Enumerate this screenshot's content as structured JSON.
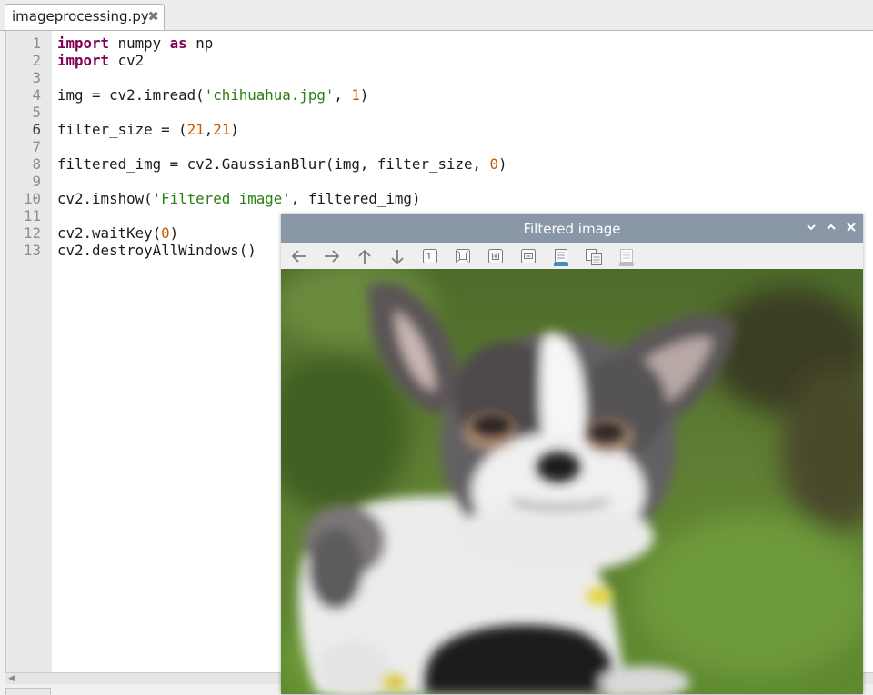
{
  "editor": {
    "tab": {
      "filename": "imageprocessing.py",
      "close_glyph": "✖"
    },
    "lines": [
      {
        "num": "1",
        "tokens": [
          {
            "t": "import",
            "c": "kw"
          },
          {
            "t": " numpy ",
            "c": ""
          },
          {
            "t": "as",
            "c": "kw"
          },
          {
            "t": " np",
            "c": ""
          }
        ]
      },
      {
        "num": "2",
        "tokens": [
          {
            "t": "import",
            "c": "kw"
          },
          {
            "t": " cv2",
            "c": ""
          }
        ]
      },
      {
        "num": "3",
        "tokens": []
      },
      {
        "num": "4",
        "tokens": [
          {
            "t": "img = cv2.imread(",
            "c": ""
          },
          {
            "t": "'chihuahua.jpg'",
            "c": "str"
          },
          {
            "t": ", ",
            "c": ""
          },
          {
            "t": "1",
            "c": "num"
          },
          {
            "t": ")",
            "c": ""
          }
        ]
      },
      {
        "num": "5",
        "tokens": []
      },
      {
        "num": "6",
        "tokens": [
          {
            "t": "filter_size = (",
            "c": ""
          },
          {
            "t": "21",
            "c": "num"
          },
          {
            "t": ",",
            "c": ""
          },
          {
            "t": "21",
            "c": "num"
          },
          {
            "t": ")",
            "c": ""
          }
        ]
      },
      {
        "num": "7",
        "tokens": []
      },
      {
        "num": "8",
        "tokens": [
          {
            "t": "filtered_img = cv2.GaussianBlur(img, filter_size, ",
            "c": ""
          },
          {
            "t": "0",
            "c": "num"
          },
          {
            "t": ")",
            "c": ""
          }
        ]
      },
      {
        "num": "9",
        "tokens": []
      },
      {
        "num": "10",
        "tokens": [
          {
            "t": "cv2.imshow(",
            "c": ""
          },
          {
            "t": "'Filtered image'",
            "c": "str"
          },
          {
            "t": ", filtered_img)",
            "c": ""
          }
        ]
      },
      {
        "num": "11",
        "tokens": []
      },
      {
        "num": "12",
        "tokens": [
          {
            "t": "cv2.waitKey(",
            "c": ""
          },
          {
            "t": "0",
            "c": "num"
          },
          {
            "t": ")",
            "c": ""
          }
        ]
      },
      {
        "num": "13",
        "tokens": [
          {
            "t": "cv2.destroyAllWindows()",
            "c": ""
          }
        ]
      }
    ],
    "current_line": "6",
    "colors": {
      "keyword": "#7f0055",
      "string": "#2a7d13",
      "number": "#c65a00"
    }
  },
  "image_window": {
    "title": "Filtered image",
    "window_buttons": [
      "chevron-down-icon",
      "chevron-up-icon",
      "close-icon"
    ],
    "toolbar_icons": [
      "arrow-left-icon",
      "arrow-right-icon",
      "arrow-up-icon",
      "arrow-down-icon",
      "zoom-original-icon",
      "zoom-fit-icon",
      "zoom-in-icon",
      "zoom-out-icon",
      "save-image-icon",
      "copy-image-icon",
      "properties-icon"
    ],
    "image_subject": "blurred chihuahua on grass"
  }
}
